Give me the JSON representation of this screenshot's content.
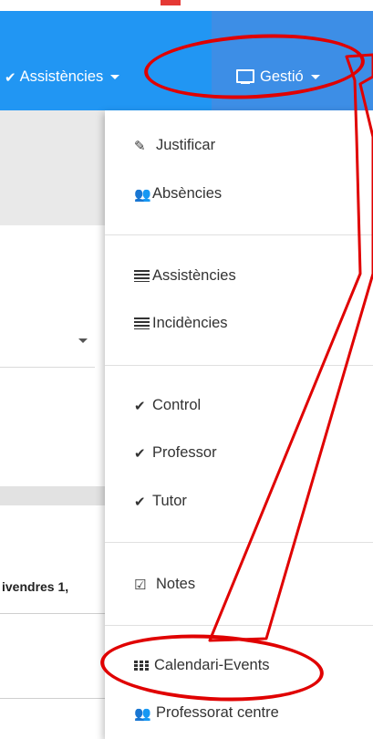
{
  "navbar": {
    "assistencies_label": "Assistències",
    "gestio_label": "Gestió",
    "color": "#2196f3"
  },
  "background": {
    "day_label": "ivendres 1,"
  },
  "menu": {
    "items": [
      {
        "icon": "pencil-icon",
        "label": "Justificar"
      },
      {
        "icon": "users-icon",
        "label": "Absències"
      },
      {
        "icon": "list-icon",
        "label": "Assistències"
      },
      {
        "icon": "list-icon",
        "label": "Incidències"
      },
      {
        "icon": "check-icon",
        "label": "Control"
      },
      {
        "icon": "check-icon",
        "label": "Professor"
      },
      {
        "icon": "check-icon",
        "label": "Tutor"
      },
      {
        "icon": "edit-icon",
        "label": "Notes"
      },
      {
        "icon": "calendar-grid-icon",
        "label": "Calendari-Events"
      },
      {
        "icon": "users-icon",
        "label": "Professorat centre"
      }
    ]
  },
  "annotation_color": "#e00000"
}
